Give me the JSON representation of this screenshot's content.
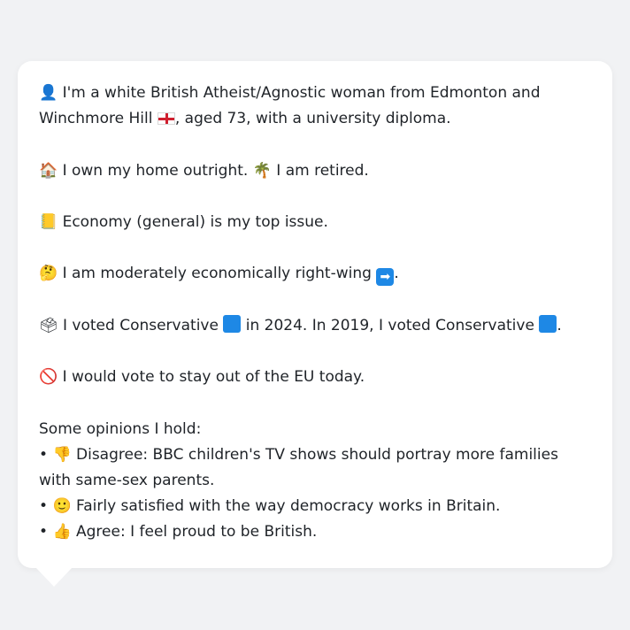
{
  "profile": {
    "intro_icon": "person-silhouette-icon",
    "intro_text_1": "I'm a white British Atheist/Agnostic woman from Edmonton and Winchmore Hill",
    "flag_icon": "england-flag-icon",
    "intro_text_2": ", aged 73, with a university diploma.",
    "home_icon": "house-icon",
    "home_text": "I own my home outright.",
    "retired_icon": "palm-tree-icon",
    "retired_text": "I am retired.",
    "issue_icon": "ledger-icon",
    "issue_text": "Economy (general) is my top issue.",
    "econ_icon": "thinking-face-icon",
    "econ_text": "I am moderately economically right-wing",
    "econ_suffix": ".",
    "vote_icon": "ballot-box-icon",
    "vote_text_1": "I voted Conservative",
    "vote_text_2": "in 2024. In 2019, I voted Conservative",
    "vote_suffix": ".",
    "eu_icon": "prohibited-icon",
    "eu_text": "I would vote to stay out of the EU today.",
    "opinions_heading": "Some opinions I hold:",
    "bullet": "•",
    "opinions": [
      {
        "icon": "thumbs-down-icon",
        "text": "Disagree: BBC children's TV shows should portray more families with same-sex parents."
      },
      {
        "icon": "slightly-smiling-face-icon",
        "text": "Fairly satisfied with the way democracy works in Britain."
      },
      {
        "icon": "thumbs-up-icon",
        "text": "Agree: I feel proud to be British."
      }
    ]
  },
  "colors": {
    "background": "#f1f2f4",
    "bubble": "#ffffff",
    "text": "#1f2328",
    "conservative_blue": "#1e88e5"
  }
}
